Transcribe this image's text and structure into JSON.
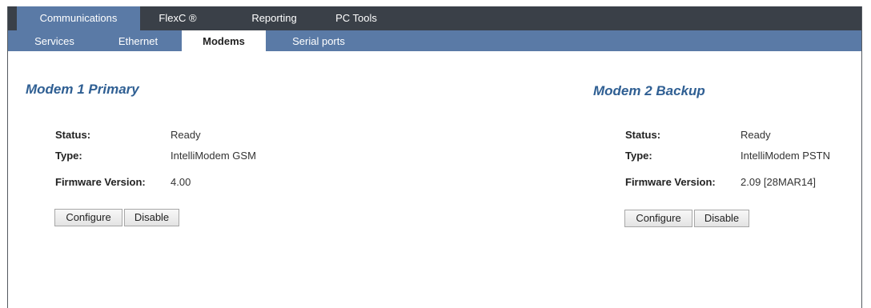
{
  "top_nav": {
    "tabs": [
      {
        "label": "Communications",
        "active": true
      },
      {
        "label": "FlexC ®",
        "active": false
      },
      {
        "label": "Reporting",
        "active": false
      },
      {
        "label": "PC Tools",
        "active": false
      }
    ]
  },
  "sub_nav": {
    "tabs": [
      {
        "label": "Services",
        "active": false
      },
      {
        "label": "Ethernet",
        "active": false
      },
      {
        "label": "Modems",
        "active": true
      },
      {
        "label": "Serial ports",
        "active": false
      }
    ]
  },
  "modems": [
    {
      "title": "Modem 1 Primary",
      "status_label": "Status:",
      "status_value": "Ready",
      "type_label": "Type:",
      "type_value": "IntelliModem GSM",
      "firmware_label": "Firmware Version:",
      "firmware_value": "4.00",
      "configure_label": "Configure",
      "disable_label": "Disable"
    },
    {
      "title": "Modem 2 Backup",
      "status_label": "Status:",
      "status_value": "Ready",
      "type_label": "Type:",
      "type_value": "IntelliModem PSTN",
      "firmware_label": "Firmware Version:",
      "firmware_value": "2.09 [28MAR14]",
      "configure_label": "Configure",
      "disable_label": "Disable"
    }
  ],
  "colors": {
    "top_bar": "#3a4048",
    "accent": "#5a7aa6",
    "title": "#2f5f93"
  }
}
